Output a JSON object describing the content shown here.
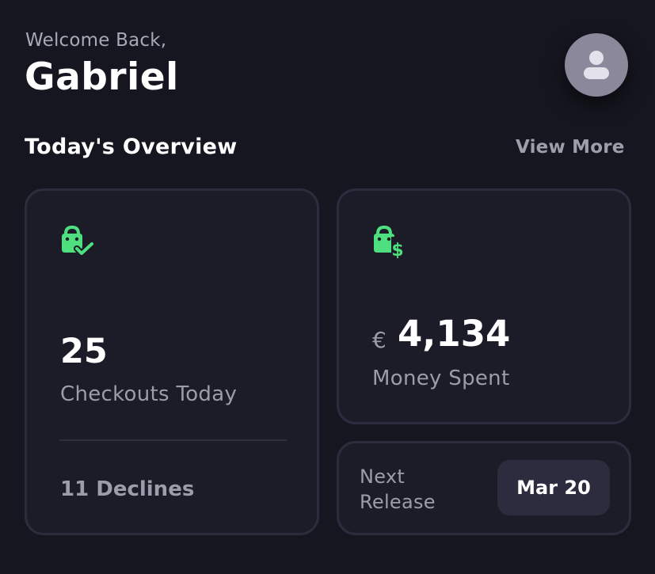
{
  "header": {
    "greeting": "Welcome Back,",
    "username": "Gabriel"
  },
  "overview": {
    "title": "Today's Overview",
    "view_more_label": "View More"
  },
  "checkouts_card": {
    "icon": "shopping-bag-check-icon",
    "count": "25",
    "label": "Checkouts Today",
    "declines": "11 Declines"
  },
  "money_card": {
    "icon": "shopping-bag-dollar-icon",
    "currency": "€",
    "amount": "4,134",
    "label": "Money Spent"
  },
  "release_card": {
    "label_line1": "Next",
    "label_line2": "Release",
    "date": "Mar 20"
  },
  "colors": {
    "background": "#161620",
    "card": "#1c1c28",
    "accent_green": "#4ee07e",
    "avatar": "#8b889c"
  }
}
